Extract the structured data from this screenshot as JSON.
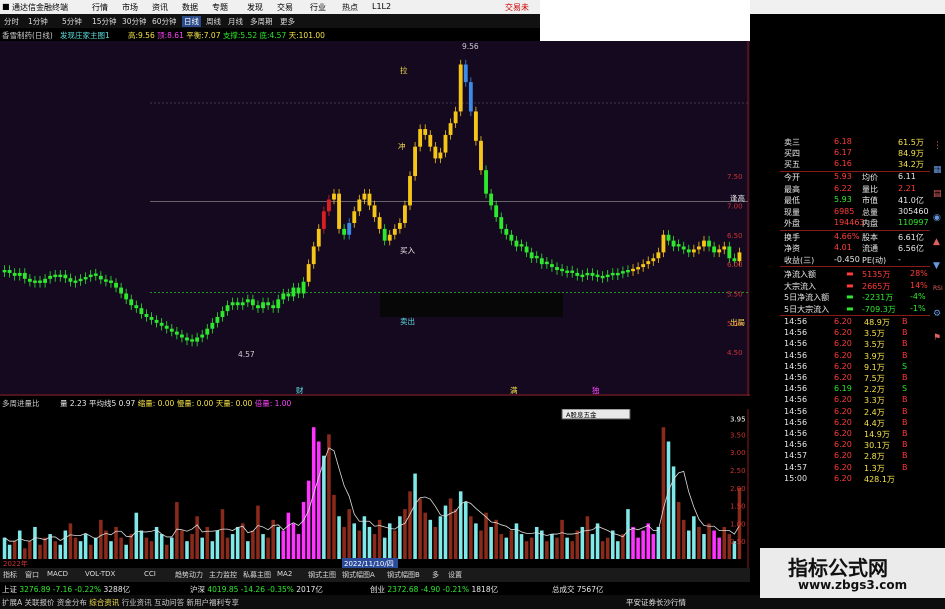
{
  "titlebar": {
    "app": "通达信金融终端",
    "menus": [
      "行情",
      "市场",
      "资讯",
      "数据",
      "专题",
      "发现",
      "交易",
      "行业",
      "热点",
      "L1L2"
    ],
    "right": "交易未"
  },
  "periods": [
    "分时",
    "1分钟",
    "5分钟",
    "15分钟",
    "30分钟",
    "60分钟",
    "日线",
    "周线",
    "月线",
    "多周期",
    "更多"
  ],
  "infobar": {
    "stock": "香雪制药(日线)",
    "indicator": "发现庄家主图1",
    "items": [
      {
        "label": "高:",
        "value": "9.56",
        "color": "#f5e14a"
      },
      {
        "label": "顶:",
        "value": "8.61",
        "color": "#ff44ff"
      },
      {
        "label": "平衡:",
        "value": "7.07",
        "color": "#f5e14a"
      },
      {
        "label": "支撑:",
        "value": "5.52",
        "color": "#2ee82e"
      },
      {
        "label": "底:",
        "value": "4.57",
        "color": "#2ee82e"
      },
      {
        "label": "天:",
        "value": "101.00",
        "color": "#f5e14a"
      }
    ]
  },
  "chart_labels": {
    "high_mark": "9.56",
    "low_mark": "4.57",
    "buy": "买入",
    "sell": "卖出",
    "la": "拉",
    "chong": "冲",
    "tuo": "逢高",
    "chu": "出局",
    "cai": "财",
    "man": "满",
    "du": "独",
    "date_label": "2022年",
    "cursor_date": "2022/11/10/四",
    "tooltip": "A股息五金"
  },
  "axis_main": [
    "7.50",
    "7.00",
    "6.50",
    "6.00",
    "5.50",
    "5.00",
    "4.50"
  ],
  "axis_vol": [
    "3.95",
    "3.50",
    "3.00",
    "2.50",
    "2.00",
    "1.50",
    "1.00",
    "0.50"
  ],
  "subinfo": {
    "name": "多周进量比",
    "items": [
      {
        "label": "量",
        "value": "2.23",
        "color": "#e8e8e8"
      },
      {
        "label": "平均线5",
        "value": "0.97",
        "color": "#e8e8e8"
      },
      {
        "label": "缩量:",
        "value": "0.00",
        "color": "#f5e14a"
      },
      {
        "label": "慢量:",
        "value": "0.00",
        "color": "#f5e14a"
      },
      {
        "label": "天量:",
        "value": "0.00",
        "color": "#f5e14a"
      },
      {
        "label": "倍量:",
        "value": "1.00",
        "color": "#ff44ff"
      }
    ]
  },
  "bottomtabs": [
    "指标",
    "窗口",
    "MACD",
    "VOL-TDX",
    "CCI",
    "趋势动力",
    "主力监控",
    "私募主图",
    "MA2",
    "钢式主图",
    "钢式幅图A",
    "钢式幅图B",
    "多",
    "设置"
  ],
  "bottomtabs_row2": [
    "扩展A",
    "关联报价",
    "资金分布",
    "综合资讯",
    "行业资讯",
    "互动问答",
    "新用户福利专享"
  ],
  "indexbar": [
    {
      "label": "上证",
      "value": "3276.89",
      "chg": "-7.16",
      "pct": "-0.22%",
      "amt": "3288亿"
    },
    {
      "label": "沪深",
      "value": "4019.85",
      "chg": "-14.26",
      "pct": "-0.35%",
      "amt": "2017亿"
    },
    {
      "label": "创业",
      "value": "2372.68",
      "chg": "-4.90",
      "pct": "-0.21%",
      "amt": "1818亿"
    },
    {
      "label": "总成交",
      "value": "7567亿",
      "chg": "",
      "pct": "",
      "amt": ""
    }
  ],
  "status_right": "平安证券长沙行情",
  "quote": {
    "ask_rows": [
      {
        "label": "卖三",
        "price": "6.18",
        "vol": "61.5万"
      },
      {
        "label": "买四",
        "price": "6.17",
        "vol": "84.9万"
      },
      {
        "label": "买五",
        "price": "6.16",
        "vol": "34.2万"
      }
    ],
    "stats": [
      {
        "l1": "今开",
        "v1": "5.93",
        "l2": "均价",
        "v2": "6.11"
      },
      {
        "l1": "最高",
        "v1": "6.22",
        "l2": "量比",
        "v2": "2.21"
      },
      {
        "l1": "最低",
        "v1": "5.93",
        "l2": "市值",
        "v2": "41.0亿"
      },
      {
        "l1": "现量",
        "v1": "6985",
        "l2": "总量",
        "v2": "305460"
      },
      {
        "l1": "外盘",
        "v1": "194463",
        "l2": "内盘",
        "v2": "110997"
      },
      {
        "l1": "换手",
        "v1": "4.66%",
        "l2": "股本",
        "v2": "6.61亿"
      },
      {
        "l1": "净资",
        "v1": "4.01",
        "l2": "流通",
        "v2": "6.56亿"
      },
      {
        "l1": "收益(三)",
        "v1": "-0.450",
        "l2": "PE(动)",
        "v2": "-"
      }
    ],
    "flows": [
      {
        "label": "净流入额",
        "value": "5135万",
        "pct": "28%"
      },
      {
        "label": "大宗流入",
        "value": "2665万",
        "pct": "14%"
      },
      {
        "label": "5日净流入额",
        "value": "-2231万",
        "pct": "-4%"
      },
      {
        "label": "5日大宗流入",
        "value": "-709.3万",
        "pct": "-1%"
      }
    ],
    "ticks": [
      {
        "time": "14:56",
        "price": "6.20",
        "vol": "48.9万",
        "side": "B"
      },
      {
        "time": "14:56",
        "price": "6.20",
        "vol": "3.5万",
        "side": "B"
      },
      {
        "time": "14:56",
        "price": "6.20",
        "vol": "3.5万",
        "side": "B"
      },
      {
        "time": "14:56",
        "price": "6.20",
        "vol": "3.9万",
        "side": "B"
      },
      {
        "time": "14:56",
        "price": "6.20",
        "vol": "9.1万",
        "side": "S"
      },
      {
        "time": "14:56",
        "price": "6.20",
        "vol": "7.5万",
        "side": "B"
      },
      {
        "time": "14:56",
        "price": "6.19",
        "price_color": "green",
        "vol": "2.2万",
        "side": "S"
      },
      {
        "time": "14:56",
        "price": "6.20",
        "vol": "3.3万",
        "side": "B"
      },
      {
        "time": "14:56",
        "price": "6.20",
        "vol": "2.4万",
        "side": "B"
      },
      {
        "time": "14:56",
        "price": "6.20",
        "vol": "4.4万",
        "side": "B"
      },
      {
        "time": "14:56",
        "price": "6.20",
        "vol": "14.9万",
        "side": "B"
      },
      {
        "time": "14:56",
        "price": "6.20",
        "vol": "30.1万",
        "side": "B"
      },
      {
        "time": "14:57",
        "price": "6.20",
        "vol": "2.8万",
        "side": "B"
      },
      {
        "time": "14:57",
        "price": "6.20",
        "vol": "1.3万",
        "side": "B"
      },
      {
        "time": "15:00",
        "price": "6.20",
        "vol": "428.1万",
        "side": ""
      }
    ],
    "right_icons": [
      "⋮",
      "▦",
      "▤",
      "◉",
      "▲",
      "▼",
      "RSI",
      "⚙",
      "⚑"
    ]
  },
  "watermark": {
    "cn": "指标公式网",
    "url": "www.zbgs3.com"
  },
  "chart_data": [
    {
      "type": "candlestick",
      "title": "香雪制药(日线)",
      "y_axis_ticks": [
        4.5,
        5.0,
        5.5,
        6.0,
        6.5,
        7.0,
        7.5
      ],
      "ylim": [
        4.35,
        9.8
      ],
      "reference_lines": [
        {
          "name": "平衡",
          "value": 7.07
        },
        {
          "name": "支撑",
          "value": 5.52
        }
      ],
      "close": [
        5.9,
        5.85,
        5.8,
        5.85,
        5.75,
        5.7,
        5.72,
        5.68,
        5.75,
        5.8,
        5.78,
        5.82,
        5.76,
        5.7,
        5.72,
        5.75,
        5.78,
        5.82,
        5.8,
        5.74,
        5.7,
        5.68,
        5.6,
        5.5,
        5.4,
        5.3,
        5.25,
        5.15,
        5.1,
        5.05,
        5.0,
        4.95,
        4.9,
        4.85,
        4.8,
        4.75,
        4.7,
        4.68,
        4.75,
        4.8,
        4.9,
        5.0,
        5.1,
        5.2,
        5.3,
        5.35,
        5.3,
        5.35,
        5.4,
        5.3,
        5.25,
        5.35,
        5.3,
        5.25,
        5.4,
        5.5,
        5.45,
        5.6,
        5.5,
        5.7,
        6.0,
        6.3,
        6.6,
        6.9,
        7.1,
        7.2,
        6.6,
        6.5,
        6.7,
        6.9,
        7.1,
        7.2,
        7.0,
        6.8,
        6.6,
        6.4,
        6.5,
        6.6,
        6.7,
        7.0,
        7.5,
        8.0,
        8.3,
        8.2,
        8.0,
        7.8,
        7.9,
        8.2,
        8.4,
        8.6,
        9.4,
        9.1,
        8.6,
        8.1,
        7.6,
        7.2,
        7.0,
        6.8,
        6.6,
        6.5,
        6.4,
        6.3,
        6.3,
        6.2,
        6.1,
        6.1,
        6.0,
        6.0,
        5.95,
        5.9,
        5.88,
        5.85,
        5.85,
        5.8,
        5.82,
        5.85,
        5.8,
        5.78,
        5.8,
        5.82,
        5.85,
        5.85,
        5.88,
        5.9,
        5.92,
        5.95,
        6.0,
        6.05,
        6.1,
        6.2,
        6.5,
        6.4,
        6.3,
        6.3,
        6.25,
        6.2,
        6.25,
        6.3,
        6.4,
        6.3,
        6.2,
        6.25,
        6.3,
        6.1,
        6.05,
        6.2
      ],
      "up": [
        1,
        0,
        0,
        1,
        0,
        0,
        1,
        0,
        1,
        1,
        0,
        1,
        0,
        0,
        1,
        1,
        1,
        1,
        0,
        0,
        0,
        0,
        0,
        0,
        0,
        0,
        0,
        0,
        0,
        0,
        0,
        0,
        0,
        0,
        0,
        0,
        0,
        0,
        1,
        1,
        1,
        1,
        1,
        1,
        1,
        1,
        0,
        1,
        1,
        0,
        0,
        1,
        0,
        0,
        1,
        1,
        0,
        1,
        0,
        1,
        1,
        1,
        1,
        1,
        1,
        1,
        0,
        0,
        1,
        1,
        1,
        1,
        0,
        0,
        0,
        0,
        1,
        1,
        1,
        1,
        1,
        1,
        1,
        0,
        0,
        0,
        1,
        1,
        1,
        1,
        1,
        0,
        0,
        0,
        0,
        0,
        0,
        0,
        0,
        0,
        0,
        0,
        0,
        0,
        0,
        0,
        0,
        0,
        0,
        0,
        0,
        0,
        0,
        0,
        1,
        1,
        0,
        0,
        1,
        1,
        1,
        1,
        1,
        1,
        1,
        1,
        1,
        1,
        1,
        1,
        1,
        0,
        0,
        0,
        0,
        0,
        1,
        1,
        1,
        0,
        0,
        1,
        1,
        0,
        0,
        1
      ]
    },
    {
      "type": "bar",
      "title": "多周进量比",
      "y_axis_ticks": [
        0.5,
        1.0,
        1.5,
        2.0,
        2.5,
        3.0,
        3.5,
        3.95
      ],
      "ylim": [
        0,
        4.1
      ],
      "values": [
        0.6,
        0.4,
        0.5,
        0.8,
        0.3,
        0.5,
        0.9,
        0.4,
        0.6,
        0.7,
        0.5,
        0.4,
        0.8,
        1.0,
        0.6,
        0.5,
        0.7,
        0.4,
        0.6,
        1.1,
        0.8,
        0.5,
        0.9,
        0.6,
        0.4,
        0.7,
        1.3,
        0.8,
        0.6,
        0.5,
        0.9,
        0.7,
        0.4,
        0.6,
        1.6,
        0.8,
        0.5,
        0.7,
        1.2,
        0.6,
        0.9,
        0.5,
        0.8,
        1.4,
        0.6,
        0.7,
        0.9,
        1.0,
        0.5,
        0.8,
        1.5,
        0.7,
        0.6,
        1.1,
        0.9,
        0.8,
        1.3,
        1.0,
        0.7,
        1.6,
        2.2,
        3.7,
        3.3,
        2.9,
        3.5,
        1.8,
        1.2,
        0.9,
        1.4,
        1.0,
        0.8,
        1.2,
        0.9,
        0.7,
        1.1,
        0.6,
        1.0,
        0.8,
        1.2,
        1.4,
        1.9,
        2.4,
        1.7,
        1.3,
        1.1,
        0.9,
        1.2,
        1.5,
        1.7,
        1.4,
        1.9,
        1.6,
        1.2,
        1.0,
        0.8,
        1.3,
        0.9,
        1.1,
        0.7,
        0.6,
        0.8,
        1.0,
        0.7,
        0.5,
        0.6,
        0.9,
        0.8,
        0.5,
        0.7,
        0.6,
        1.1,
        0.6,
        0.5,
        0.8,
        0.9,
        1.2,
        0.7,
        1.0,
        0.5,
        0.6,
        0.8,
        0.5,
        0.7,
        1.4,
        0.9,
        0.6,
        0.8,
        1.0,
        0.7,
        0.9,
        3.7,
        3.3,
        2.6,
        1.6,
        1.1,
        0.8,
        1.2,
        0.9,
        0.7,
        1.0,
        0.8,
        0.6,
        0.9,
        0.7,
        0.5,
        2.0
      ],
      "magenta_ranges": [
        [
          55,
          62
        ],
        [
          124,
          128
        ],
        [
          140,
          141
        ]
      ],
      "avg_line_period": 5
    }
  ]
}
